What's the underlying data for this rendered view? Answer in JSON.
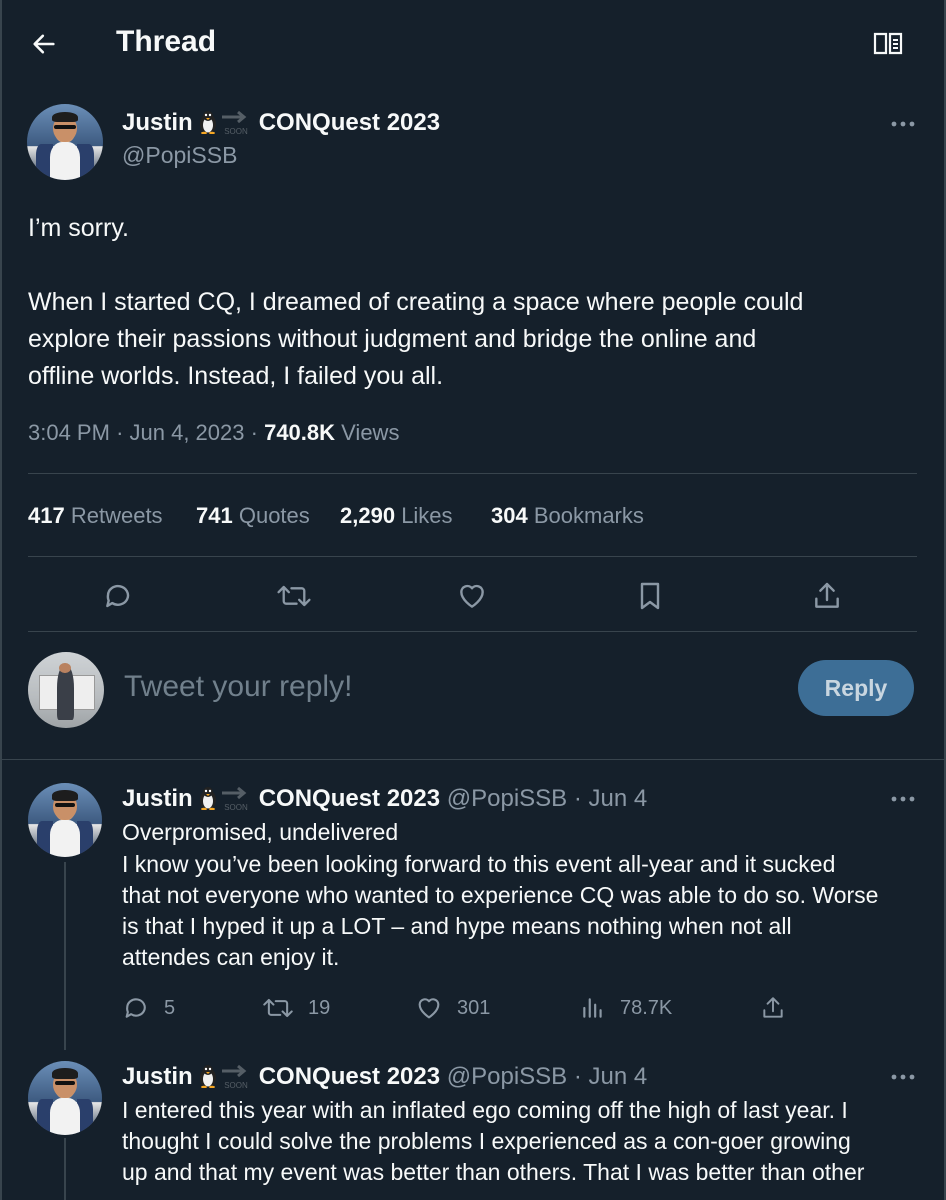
{
  "header": {
    "title": "Thread",
    "back_icon": "arrow-left-icon",
    "reader_icon": "reader-mode-icon"
  },
  "main_tweet": {
    "display_name": "Justin",
    "soon_text": "SOON",
    "display_name_suffix": "CONQuest 2023",
    "handle": "@PopiSSB",
    "text_line1": "I’m sorry.",
    "text_para2_l1": "When I started CQ, I dreamed of creating a space where people could",
    "text_para2_l2": "explore their passions without judgment and bridge the online and",
    "text_para2_l3": "offline worlds. Instead, I failed you all.",
    "time": "3:04 PM",
    "sep": "·",
    "date": "Jun 4, 2023",
    "views_count": "740.8K",
    "views_label": "Views",
    "retweets_count": "417",
    "retweets_label": "Retweets",
    "quotes_count": "741",
    "quotes_label": "Quotes",
    "likes_count": "2,290",
    "likes_label": "Likes",
    "bookmarks_count": "304",
    "bookmarks_label": "Bookmarks"
  },
  "composer": {
    "placeholder": "Tweet your reply!",
    "button": "Reply"
  },
  "replies": [
    {
      "display_name": "Justin",
      "soon_text": "SOON",
      "display_name_suffix": "CONQuest 2023",
      "handle": "@PopiSSB",
      "sep": "·",
      "date": "Jun 4",
      "line1": "Overpromised, undelivered",
      "line2": "I know you’ve been looking forward to this event all-year and it sucked",
      "line3": "that not everyone who wanted to experience CQ was able to do so. Worse",
      "line4": "is that I hyped it up a LOT – and hype means nothing when not all",
      "line5": "attendes can enjoy it.",
      "replies_count": "5",
      "retweets_count": "19",
      "likes_count": "301",
      "views_count": "78.7K"
    },
    {
      "display_name": "Justin",
      "soon_text": "SOON",
      "display_name_suffix": "CONQuest 2023",
      "handle": "@PopiSSB",
      "sep": "·",
      "date": "Jun 4",
      "line1": "I entered this year with an inflated ego coming off the high of last year. I",
      "line2": "thought I could solve the problems I experienced as a con-goer growing",
      "line3": "up and that my event was better than others. That I was better than other"
    }
  ],
  "colors": {
    "background": "#15202b",
    "text": "#f7f9f9",
    "muted": "#8b98a5",
    "divider": "#38444d",
    "reply_button": "#3d6e96"
  }
}
